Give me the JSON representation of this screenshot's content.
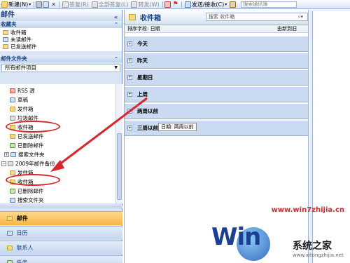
{
  "toolbar": {
    "new_label": "新建(N)",
    "reply_label": "答复(R)",
    "reply_all_label": "全部答复(L)",
    "forward_label": "转发(W)",
    "send_receive_label": "发送/接收(C)",
    "search_addr_placeholder": "搜索通讯簿"
  },
  "nav": {
    "title": "邮件",
    "favorites_header": "收藏夹",
    "favorites": [
      "收件箱",
      "未读邮件",
      "已发送邮件"
    ],
    "mail_folders_header": "邮件文件夹",
    "all_mail_items": "所有邮件项目",
    "tree": {
      "rss": "RSS 源",
      "drafts": "草稿",
      "outbox": "发件箱",
      "junk": "垃圾邮件",
      "inbox": "收件箱",
      "sent": "已发送邮件",
      "deleted": "已删除邮件",
      "search": "搜索文件夹",
      "backup": "2009年邮件备份",
      "b_outbox": "发件箱",
      "b_inbox": "收件箱",
      "b_deleted": "已删除邮件",
      "b_search": "搜索文件夹"
    },
    "buttons": [
      "邮件",
      "日历",
      "联系人",
      "任务"
    ]
  },
  "list": {
    "title": "收件箱",
    "search_placeholder": "搜索 收件箱",
    "arrange_by": "排序字段: 日期",
    "arrange_order": "由新到旧",
    "groups": [
      "今天",
      "昨天",
      "星期日",
      "上周",
      "两周以前",
      "三周以前"
    ],
    "tooltip": "日期: 两周以前"
  },
  "watermark": {
    "url": "www.win7zhijia.cn",
    "logo_text": "Win",
    "brand": "系统之家",
    "brand_url": "www.xitongzhijia.net"
  },
  "colors": {
    "accent": "#15428b",
    "annotation_red": "#d8262b",
    "active_nav": "#f7b548"
  }
}
